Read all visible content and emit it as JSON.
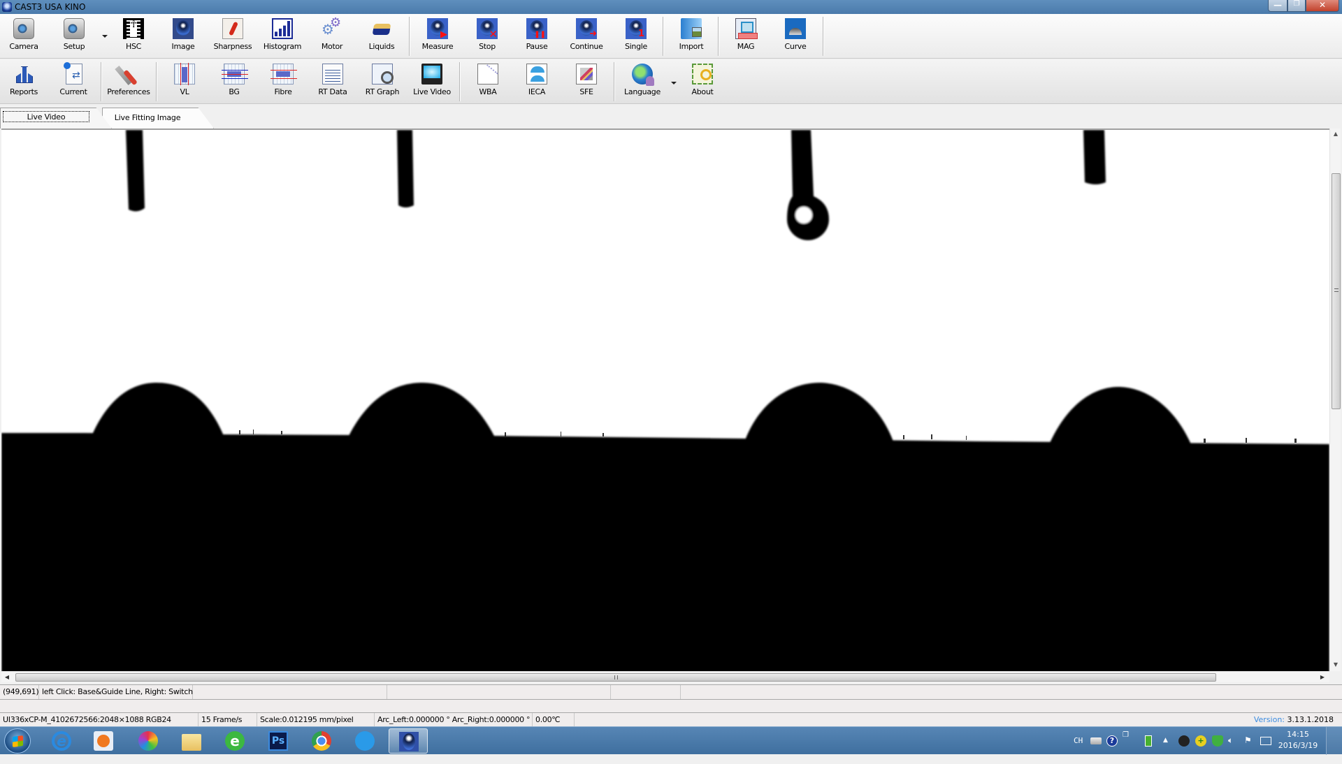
{
  "window": {
    "title": "CAST3  USA KINO",
    "controls": {
      "minimize": "—",
      "maximize": "❐",
      "close": "✕"
    }
  },
  "toolbar1": {
    "items": [
      {
        "label": "Camera",
        "icon": "camera-icon"
      },
      {
        "label": "Setup",
        "icon": "camera-setup-icon",
        "has_dropdown": true
      },
      {
        "label": "HSC",
        "icon": "film-strip-icon"
      },
      {
        "label": "Image",
        "icon": "sphere-image-icon"
      },
      {
        "label": "Sharpness",
        "icon": "chili-sharpness-icon"
      },
      {
        "label": "Histogram",
        "icon": "histogram-icon"
      },
      {
        "label": "Motor",
        "icon": "gears-icon"
      },
      {
        "label": "Liquids",
        "icon": "liquid-tray-icon"
      },
      {
        "label": "Measure",
        "icon": "measure-play-icon",
        "mark": "▶"
      },
      {
        "label": "Stop",
        "icon": "stop-x-icon",
        "mark": "✕"
      },
      {
        "label": "Pause",
        "icon": "pause-icon",
        "mark": "❚❚"
      },
      {
        "label": "Continue",
        "icon": "continue-arrow-icon",
        "mark": "➜"
      },
      {
        "label": "Single",
        "icon": "single-one-icon",
        "mark": "1"
      },
      {
        "label": "Import",
        "icon": "import-folder-icon"
      },
      {
        "label": "MAG",
        "icon": "magnification-ruler-icon"
      },
      {
        "label": "Curve",
        "icon": "curve-drop-icon"
      }
    ]
  },
  "toolbar2": {
    "items": [
      {
        "label": "Reports",
        "icon": "reports-icon"
      },
      {
        "label": "Current",
        "icon": "current-document-icon"
      },
      {
        "label": "Preferences",
        "icon": "wrench-gear-icon"
      },
      {
        "label": "VL",
        "icon": "vertical-line-icon"
      },
      {
        "label": "BG",
        "icon": "baseline-guide-icon"
      },
      {
        "label": "Fibre",
        "icon": "fibre-icon"
      },
      {
        "label": "RT Data",
        "icon": "rt-data-table-icon"
      },
      {
        "label": "RT Graph",
        "icon": "rt-graph-magnifier-icon"
      },
      {
        "label": "Live Video",
        "icon": "monitor-icon"
      },
      {
        "label": "WBA",
        "icon": "wba-chart-icon"
      },
      {
        "label": "IECA",
        "icon": "ieca-drops-icon"
      },
      {
        "label": "SFE",
        "icon": "sfe-chart-icon"
      },
      {
        "label": "Language",
        "icon": "globe-user-icon",
        "has_dropdown": true
      },
      {
        "label": "About",
        "icon": "certificate-key-icon"
      }
    ]
  },
  "tabs": [
    {
      "label": "Live Video",
      "active": true
    },
    {
      "label": "Live Fitting Image",
      "active": false
    }
  ],
  "viewport": {
    "content": "live contact-angle video: 4 sessile drops on substrate with 4 dispensing needles",
    "scrollbars": {
      "up": "▲",
      "down": "▼",
      "left": "◀",
      "right": "▶"
    }
  },
  "status": {
    "cursor_coords": "(949,691)",
    "hint": "left Click: Base&Guide Line, Right: Switch",
    "camera_info": "UI336xCP-M_4102672566:2048×1088  RGB24",
    "frame_rate": "15  Frame/s",
    "scale": "Scale:0.012195 mm/pixel",
    "arcs": "Arc_Left:0.000000 °  Arc_Right:0.000000 °",
    "temperature": "0.00℃",
    "version_label": "Version:",
    "version_value": "3.13.1.2018"
  },
  "taskbar": {
    "apps": [
      {
        "name": "internet-explorer",
        "icon": "ie-icon"
      },
      {
        "name": "media-player",
        "icon": "media-player-icon"
      },
      {
        "name": "photo-viewer",
        "icon": "pinwheel-icon"
      },
      {
        "name": "file-explorer",
        "icon": "folder-icon"
      },
      {
        "name": "browser-green",
        "icon": "green-e-browser-icon"
      },
      {
        "name": "photoshop",
        "icon": "photoshop-icon",
        "text": "Ps"
      },
      {
        "name": "chrome",
        "icon": "chrome-icon"
      },
      {
        "name": "feather-app",
        "icon": "blue-feather-icon"
      },
      {
        "name": "cast3",
        "icon": "cast3-app-icon",
        "active": true
      }
    ],
    "tray": {
      "language": "CH",
      "icons": [
        "keyboard-icon",
        "help-icon",
        "window-switch-icon",
        "usb-drive-icon",
        "show-hidden-icon",
        "network-satellite-icon",
        "security-plus-icon",
        "shield-icon",
        "volume-icon",
        "action-center-flag-icon",
        "network-icon"
      ]
    },
    "time": "14:15",
    "date": "2016/3/19"
  }
}
